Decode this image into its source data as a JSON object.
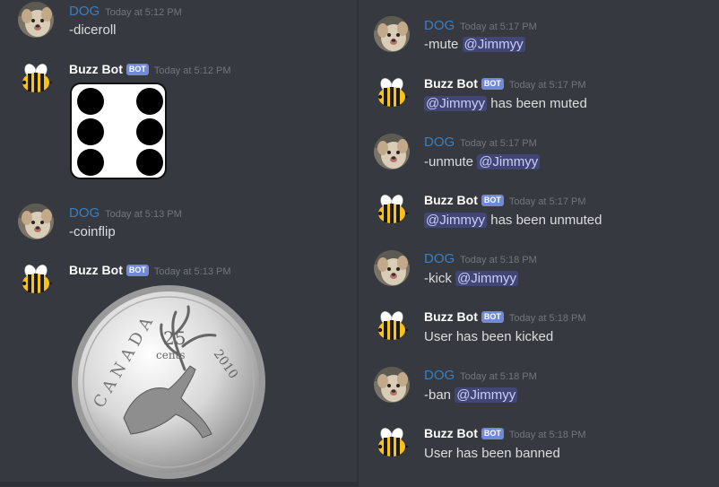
{
  "colors": {
    "background": "#36393f",
    "dog_name": "#3a7fc1",
    "bot_tag": "#7289da",
    "mention_bg": "#414675"
  },
  "left_messages": [
    {
      "author": "DOG",
      "timestamp": "Today at 5:12 PM",
      "text": "-diceroll"
    },
    {
      "author": "Buzz Bot",
      "tag": "BOT",
      "timestamp": "Today at 5:12 PM",
      "attachment": "dice-six-image"
    },
    {
      "author": "DOG",
      "timestamp": "Today at 5:13 PM",
      "text": "-coinflip"
    },
    {
      "author": "Buzz Bot",
      "tag": "BOT",
      "timestamp": "Today at 5:13 PM",
      "attachment": "canada-quarter-coin-image"
    }
  ],
  "coin": {
    "denomination": "25",
    "unit": "cents",
    "year": "2010",
    "country": "CANADA"
  },
  "right_messages": [
    {
      "author": "DOG",
      "timestamp": "Today at 5:17 PM",
      "pre": "-mute ",
      "mention": "@Jimmyy",
      "post": ""
    },
    {
      "author": "Buzz Bot",
      "tag": "BOT",
      "timestamp": "Today at 5:17 PM",
      "pre": "",
      "mention": "@Jimmyy",
      "post": " has been muted"
    },
    {
      "author": "DOG",
      "timestamp": "Today at 5:17 PM",
      "pre": "-unmute ",
      "mention": "@Jimmyy",
      "post": ""
    },
    {
      "author": "Buzz Bot",
      "tag": "BOT",
      "timestamp": "Today at 5:17 PM",
      "pre": "",
      "mention": "@Jimmyy",
      "post": " has been unmuted"
    },
    {
      "author": "DOG",
      "timestamp": "Today at 5:18 PM",
      "pre": "-kick ",
      "mention": "@Jimmyy",
      "post": ""
    },
    {
      "author": "Buzz Bot",
      "tag": "BOT",
      "timestamp": "Today at 5:18 PM",
      "text": "User has been kicked"
    },
    {
      "author": "DOG",
      "timestamp": "Today at 5:18 PM",
      "pre": "-ban ",
      "mention": "@Jimmyy",
      "post": ""
    },
    {
      "author": "Buzz Bot",
      "tag": "BOT",
      "timestamp": "Today at 5:18 PM",
      "text": "User has been banned"
    }
  ]
}
